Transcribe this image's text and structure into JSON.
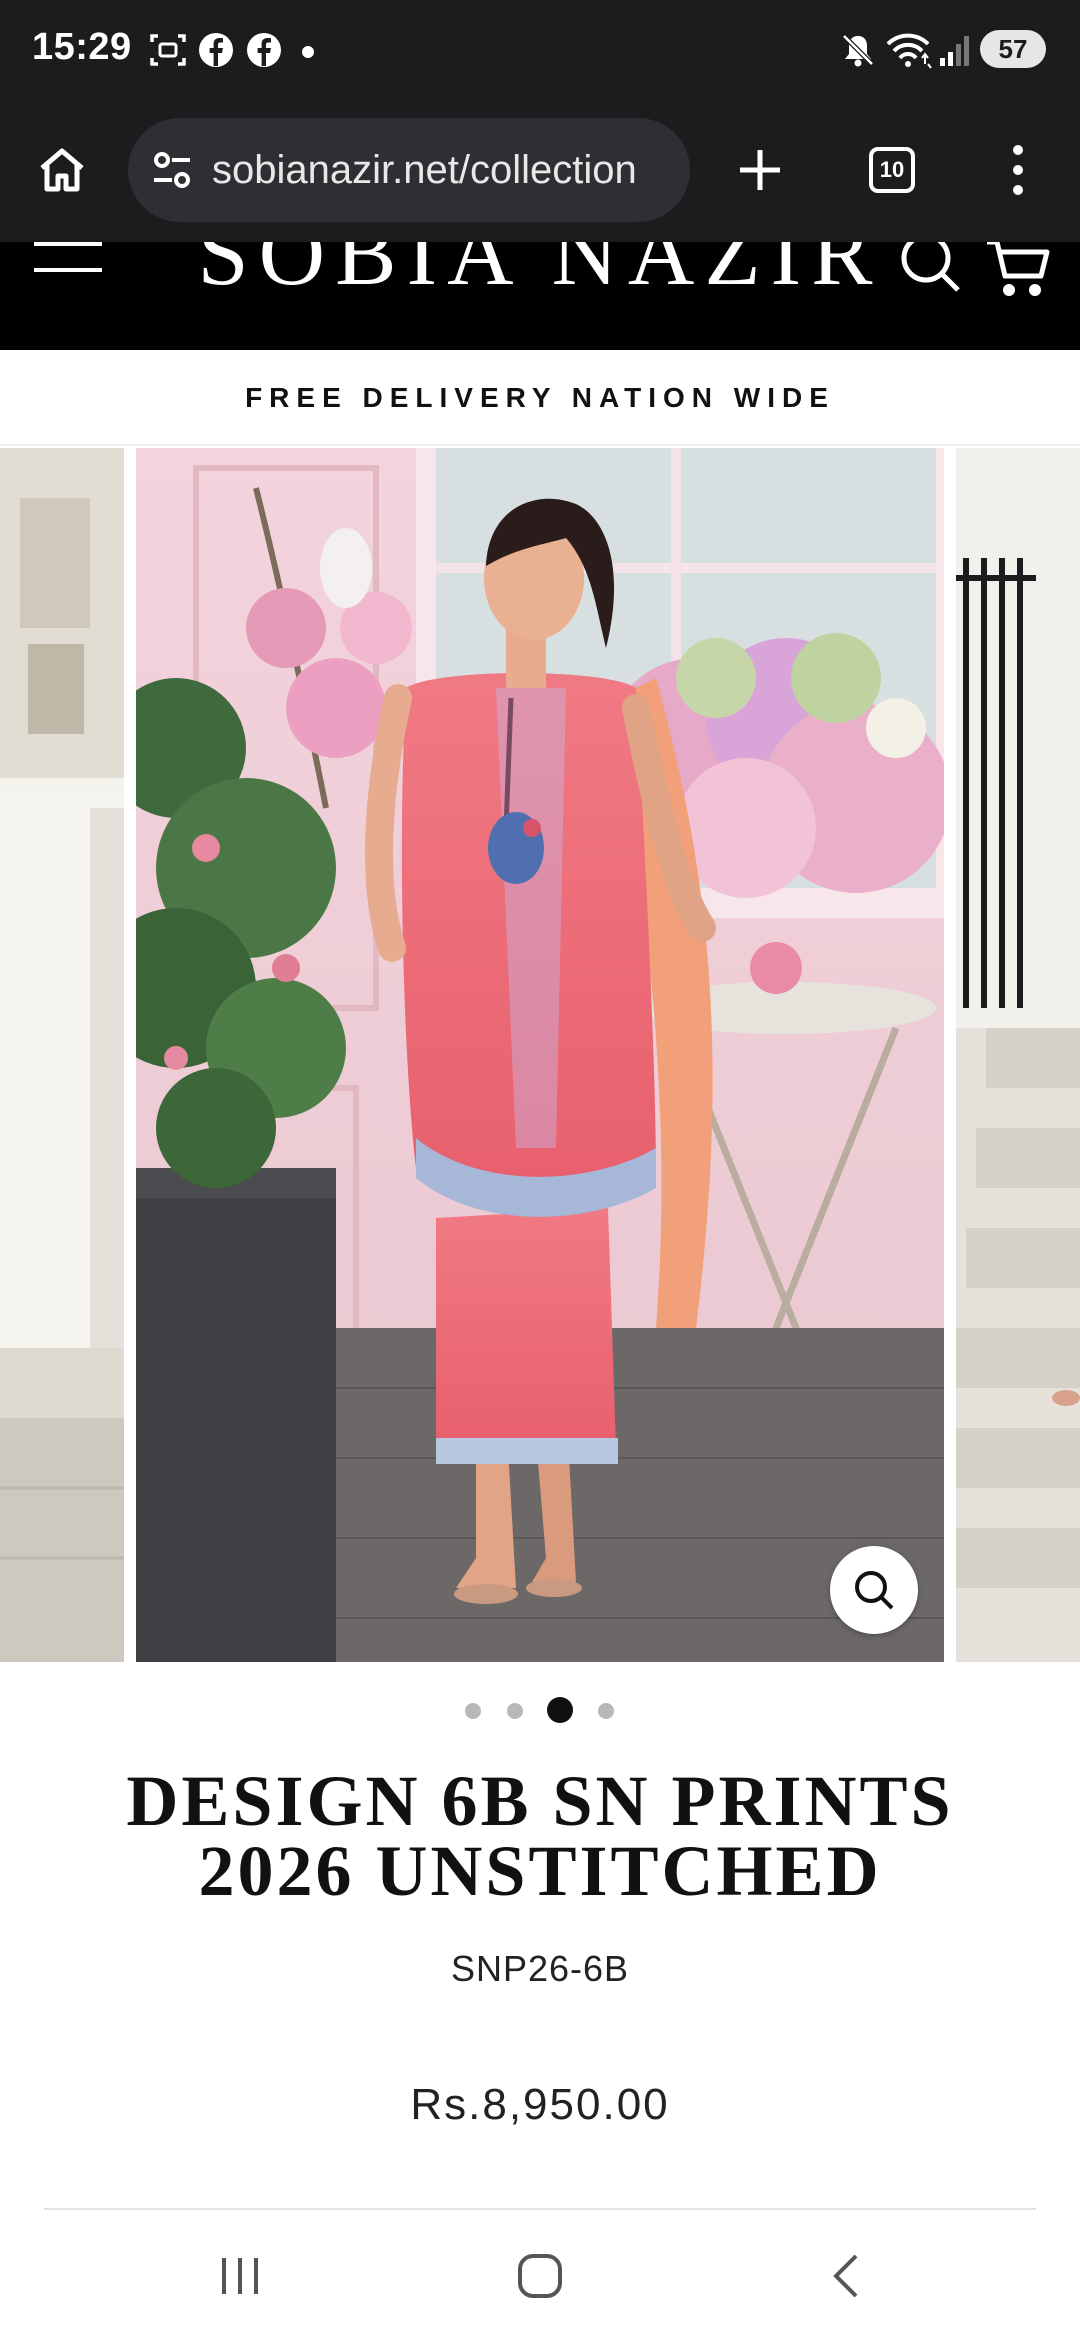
{
  "status_bar": {
    "time": "15:29",
    "battery": "57",
    "icons": [
      "screenshot-icon",
      "facebook-icon",
      "facebook-icon",
      "notification-dot",
      "mute-icon",
      "wifi-icon",
      "signal-icon",
      "battery-icon"
    ]
  },
  "browser": {
    "url": "sobianazir.net/collection",
    "tab_count": "10",
    "icons": [
      "home-icon",
      "site-settings-icon",
      "new-tab-icon",
      "tabs-icon",
      "more-menu-icon"
    ]
  },
  "site": {
    "logo": "SOBIA NAZIR",
    "announcement": "FREE DELIVERY NATION WIDE"
  },
  "gallery": {
    "slide_count": 4,
    "active_slide": 3
  },
  "product": {
    "title_line1": "DESIGN 6B SN PRINTS",
    "title_line2": "2026 UNSTITCHED",
    "sku": "SNP26-6B",
    "price": "Rs.8,950.00"
  },
  "colors": {
    "dark_bar": "#1c1c1e",
    "header": "#000000",
    "dress_pink": "#ee6a77"
  },
  "nav": {
    "icons": [
      "recent-apps-icon",
      "home-button-icon",
      "back-icon"
    ]
  }
}
